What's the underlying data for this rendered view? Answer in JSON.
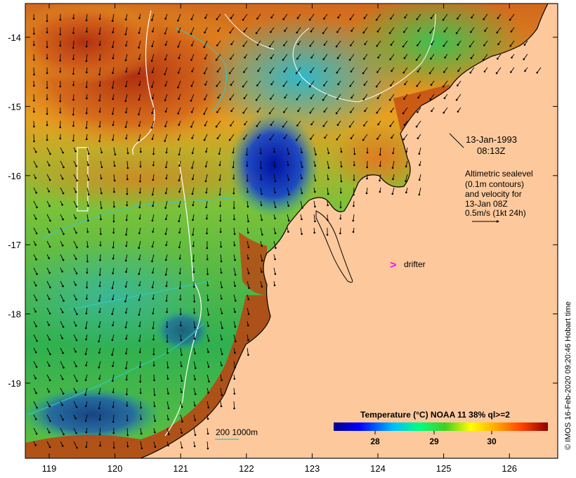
{
  "map": {
    "lon_ticks": [
      "119",
      "120",
      "121",
      "122",
      "123",
      "124",
      "125",
      "126"
    ],
    "lat_ticks": [
      "-14",
      "-15",
      "-16",
      "-17",
      "-18",
      "-19"
    ],
    "lon_range": [
      118.6,
      126.7
    ],
    "lat_range": [
      -20.1,
      -13.55
    ]
  },
  "annotations": {
    "date": "13-Jan-1993",
    "time": "08:13Z",
    "altimetry_line1": "Altimetric sealevel",
    "altimetry_line2": "(0.1m contours)",
    "altimetry_line3": "and velocity for",
    "altimetry_line4": "13-Jan 08Z",
    "altimetry_line5": "0.5m/s (1kt 24h)",
    "drifter_marker": ">",
    "drifter_label": "drifter",
    "depth_label": "200  1000m"
  },
  "legend": {
    "title": "Temperature (°C) NOAA 11 38% ql>=2",
    "ticks": [
      "28",
      "29",
      "30"
    ]
  },
  "credit": "© IMOS 16-Feb-2020 09:20:46 Hobart time",
  "colors": {
    "land": "#fdc99c",
    "drifter": "#ff00ff",
    "contour": "#ffffff",
    "depth_contour": "#33cccc",
    "arrow": "#000000"
  }
}
